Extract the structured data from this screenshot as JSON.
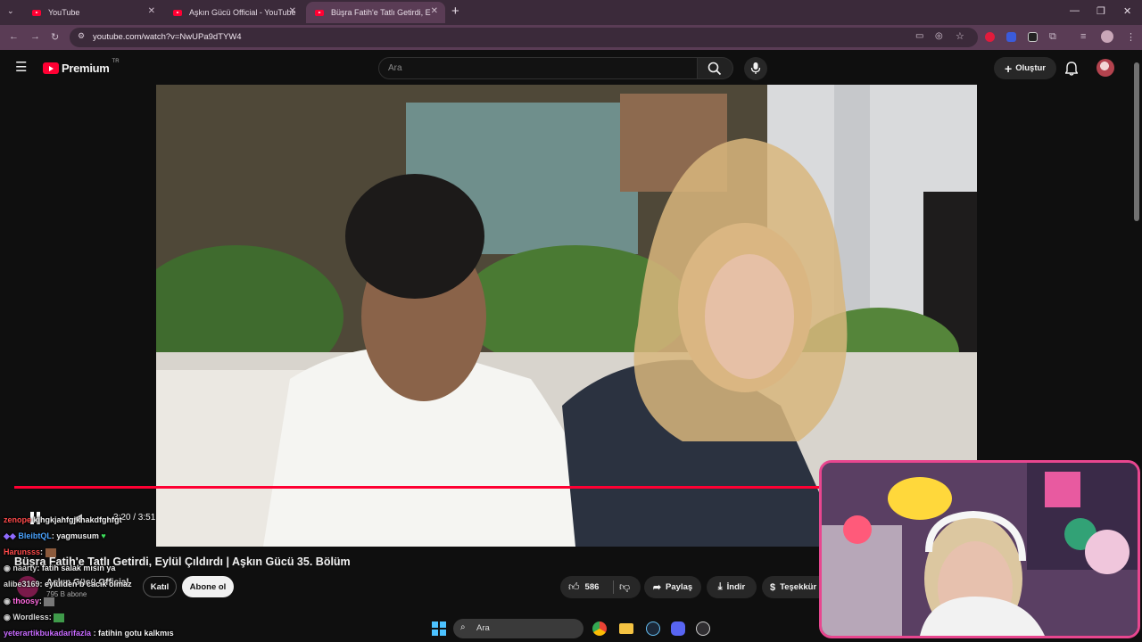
{
  "browser": {
    "tabs": [
      {
        "title": "YouTube"
      },
      {
        "title": "Aşkın Gücü Official - YouTube"
      },
      {
        "title": "Büşra Fatih'e Tatlı Getirdi, E"
      }
    ],
    "url": "youtube.com/watch?v=NwUPa9dTYW4"
  },
  "youtube": {
    "logo_text": "Premium",
    "region": "TR",
    "search_placeholder": "Ara",
    "create_label": "Oluştur"
  },
  "player": {
    "time": "3:20 / 3:51",
    "progress_fraction": 0.87
  },
  "video": {
    "title": "Büşra Fatih'e Tatlı Getirdi, Eylül Çıldırdı | Aşkın Gücü 35. Bölüm",
    "channel": "Aşkın Gücü Official",
    "subscribers": "795 B abone",
    "join_label": "Katıl",
    "subscribe_label": "Abone ol",
    "likes": "586",
    "share_label": "Paylaş",
    "download_label": "İndir",
    "thanks_label": "Teşekkür"
  },
  "chat": [
    {
      "user": "zenope",
      "text": "kjhgkjahfgjkhakdfghfgt",
      "color": "#ff4a4a"
    },
    {
      "user": "BleibtQL",
      "text": ": yagmusum",
      "color": "#4aa3ff"
    },
    {
      "user": "Harunsss",
      "text": ":",
      "color": "#ff4a4a"
    },
    {
      "user": "naarty",
      "text": ": fatih salak mısın ya",
      "color": "#d8d8d8"
    },
    {
      "user": "alibe3169",
      "text": ": eylülden b cacık olmaz",
      "color": "#d8d8d8"
    },
    {
      "user": "thoosy",
      "text": ":",
      "color": "#ff6adf"
    },
    {
      "user": "Wordless",
      "text": ":",
      "color": "#d8d8d8"
    },
    {
      "user": "yeterartikbukadarifazla",
      "text": ": fatihin gotu kalkmıs",
      "color": "#c86bff"
    }
  ],
  "taskbar": {
    "search_placeholder": "Ara"
  },
  "colors": {
    "accent": "#ff0033",
    "cam_border": "#e8468f",
    "browser_frame": "#3b2a3a"
  }
}
